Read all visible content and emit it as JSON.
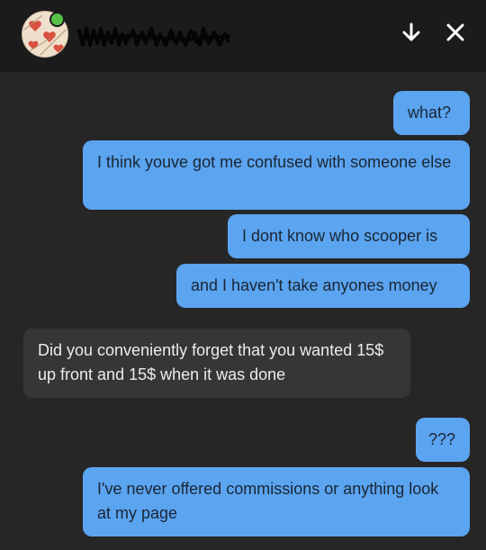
{
  "header": {
    "avatar_icon": "avatar-hearts",
    "username_redacted": true,
    "online_status_color": "#56c24a",
    "down_icon": "arrow-down-icon",
    "close_icon": "close-icon"
  },
  "colors": {
    "outgoing_bubble": "#5ba4f0",
    "incoming_bubble": "#363636",
    "background": "#262626"
  },
  "messages": [
    {
      "direction": "outgoing",
      "text": "what?"
    },
    {
      "direction": "outgoing",
      "text": "I think youve got me confused with someone else"
    },
    {
      "direction": "outgoing",
      "text": "I dont know who scooper is"
    },
    {
      "direction": "outgoing",
      "text": "and I haven't take anyones money"
    },
    {
      "direction": "incoming",
      "text": "Did you conveniently forget that you wanted 15$ up front and 15$ when it was done"
    },
    {
      "direction": "outgoing",
      "text": "???"
    },
    {
      "direction": "outgoing",
      "text": "I've never offered commissions or anything look at my page"
    }
  ]
}
